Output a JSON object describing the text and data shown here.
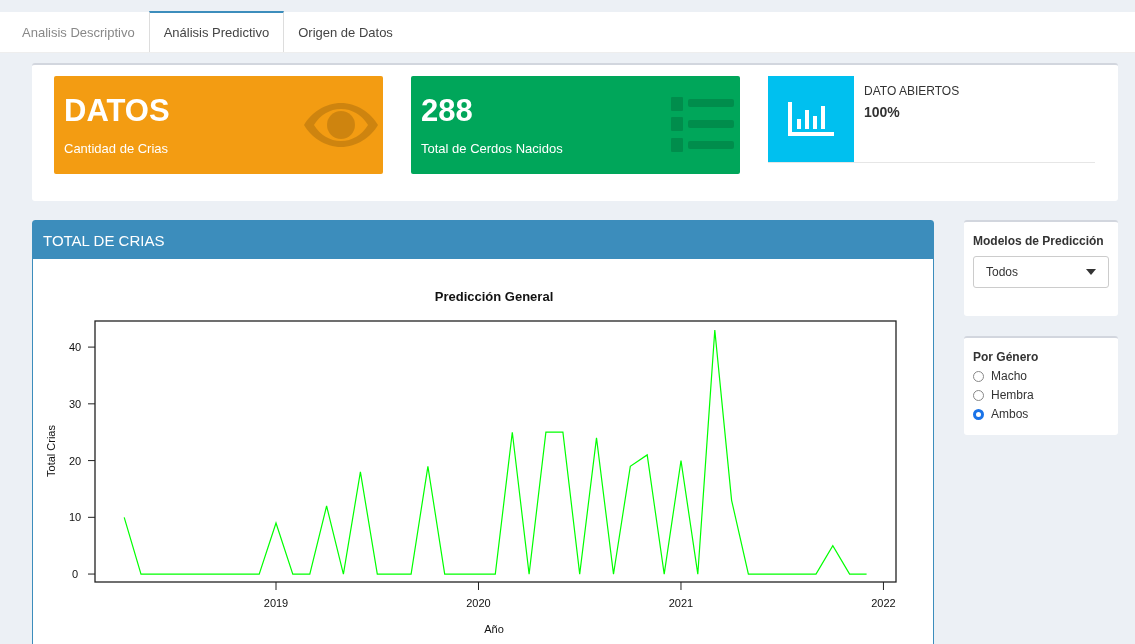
{
  "tabs": [
    {
      "label": "Analisis Descriptivo",
      "selected": false
    },
    {
      "label": "Análisis Predictivo",
      "selected": true
    },
    {
      "label": "Origen de Datos",
      "selected": false
    }
  ],
  "info_boxes": [
    {
      "kind": "solid",
      "value": "DATOS",
      "caption": "Cantidad de Crias",
      "color": "#f39c12"
    },
    {
      "kind": "solid",
      "value": "288",
      "caption": "Total de Cerdos Nacidos",
      "color": "#00a65a"
    },
    {
      "kind": "side",
      "caption": "DATO ABIERTOS",
      "value": "100%",
      "color": "#00c0ef"
    }
  ],
  "chart_box": {
    "title": "TOTAL DE CRIAS",
    "chart_data": {
      "type": "line",
      "title": "Predicción General",
      "xlabel": "Año",
      "ylabel": "Total Crias",
      "x": [
        2018.25,
        2018.333,
        2018.417,
        2018.5,
        2018.583,
        2018.667,
        2018.75,
        2018.833,
        2018.917,
        2019,
        2019.083,
        2019.167,
        2019.25,
        2019.333,
        2019.417,
        2019.5,
        2019.583,
        2019.667,
        2019.75,
        2019.833,
        2019.917,
        2020,
        2020.083,
        2020.167,
        2020.25,
        2020.333,
        2020.417,
        2020.5,
        2020.583,
        2020.667,
        2020.75,
        2020.833,
        2020.917,
        2021,
        2021.083,
        2021.167,
        2021.25,
        2021.333,
        2021.417,
        2021.5,
        2021.583,
        2021.667,
        2021.75,
        2021.833,
        2021.917
      ],
      "series": [
        {
          "color": "#00ff00",
          "values": [
            10,
            0,
            0,
            0,
            0,
            0,
            0,
            0,
            0,
            9,
            0,
            0,
            12,
            0,
            18,
            0,
            0,
            0,
            19,
            0,
            0,
            0,
            0,
            25,
            0,
            25,
            25,
            0,
            24,
            0,
            19,
            21,
            0,
            20,
            0,
            43,
            13,
            0,
            0,
            0,
            0,
            0,
            5,
            0,
            0
          ]
        }
      ],
      "xlim": [
        2018.106,
        2022.062
      ],
      "ylim": [
        -1.4,
        44.6
      ],
      "xticks": [
        2019,
        2020,
        2021,
        2022
      ],
      "yticks": [
        0,
        10,
        20,
        30,
        40
      ]
    }
  },
  "models": {
    "title": "Modelos de Predicción",
    "value": "Todos"
  },
  "gender": {
    "title": "Por Género",
    "options": [
      {
        "label": "Macho",
        "selected": false
      },
      {
        "label": "Hembra",
        "selected": false
      },
      {
        "label": "Ambos",
        "selected": true
      }
    ]
  }
}
